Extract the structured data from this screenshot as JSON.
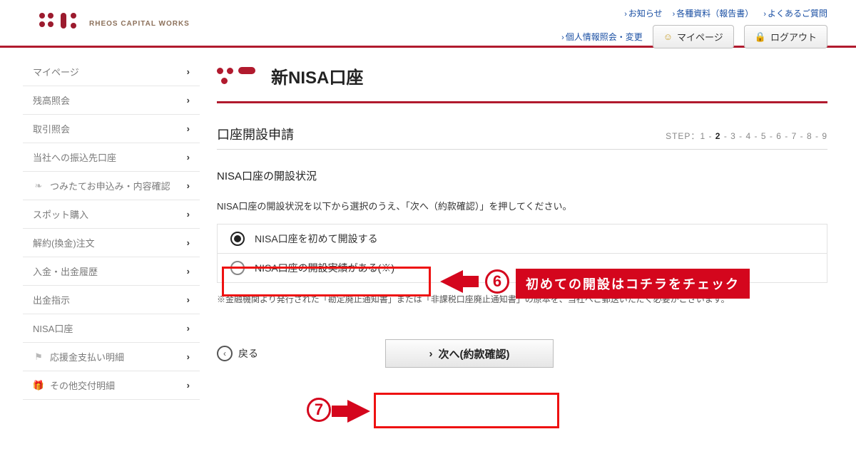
{
  "brand": {
    "name": "RHEOS CAPITAL WORKS"
  },
  "header": {
    "links": [
      "お知らせ",
      "各種資料（報告書）",
      "よくあるご質問"
    ],
    "sublink": "個人情報照会・変更",
    "mypage": "マイページ",
    "logout": "ログアウト"
  },
  "sidebar": {
    "items": [
      {
        "label": "マイページ"
      },
      {
        "label": "残高照会"
      },
      {
        "label": "取引照会"
      },
      {
        "label": "当社への振込先口座"
      },
      {
        "label": "つみたてお申込み・内容確認",
        "icon": "sprout"
      },
      {
        "label": "スポット購入"
      },
      {
        "label": "解約(換金)注文"
      },
      {
        "label": "入金・出金履歴"
      },
      {
        "label": "出金指示"
      },
      {
        "label": "NISA口座"
      },
      {
        "label": "応援金支払い明細",
        "icon": "flag"
      },
      {
        "label": "その他交付明細",
        "icon": "gift"
      }
    ]
  },
  "main": {
    "title": "新NISA口座",
    "subtitle": "口座開設申請",
    "step_prefix": "STEP：",
    "steps": [
      "1",
      "2",
      "3",
      "4",
      "5",
      "6",
      "7",
      "8",
      "9"
    ],
    "current_step": "2",
    "section": "NISA口座の開設状況",
    "lead": "NISA口座の開設状況を以下から選択のうえ、「次へ（約款確認）」を押してください。",
    "options": [
      {
        "label": "NISA口座を初めて開設する",
        "selected": true
      },
      {
        "label": "NISA口座の開設実績がある(※)",
        "selected": false
      }
    ],
    "note": "※金融機関より発行された「勘定廃止通知書」または「非課税口座廃止通知書」の原本を、当社へご郵送いただく必要がございます。",
    "back": "戻る",
    "next": "次へ(約款確認)"
  },
  "annotations": {
    "num6": "6",
    "label6": "初めての開設はコチラをチェック",
    "num7": "7"
  }
}
